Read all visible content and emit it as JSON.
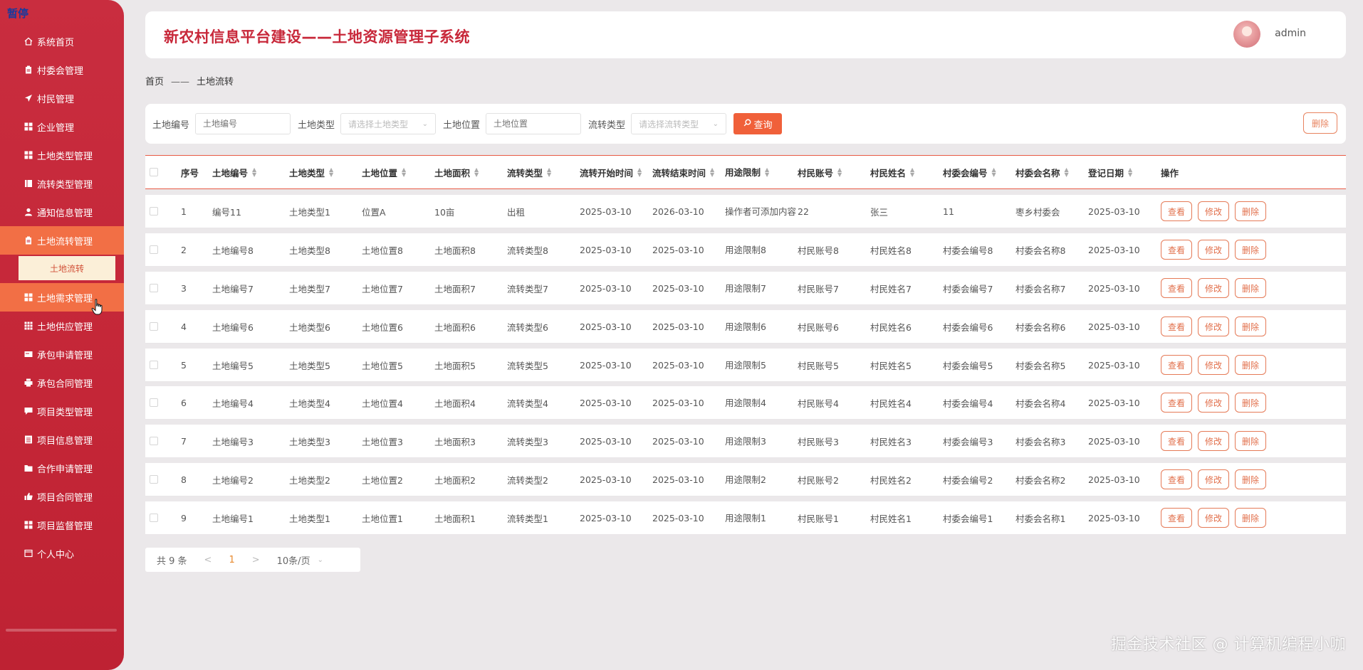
{
  "overlay": {
    "pause_label": "暂停"
  },
  "sidebar": {
    "items": [
      {
        "label": "系统首页",
        "icon": "home-icon"
      },
      {
        "label": "村委会管理",
        "icon": "clipboard-icon"
      },
      {
        "label": "村民管理",
        "icon": "send-icon"
      },
      {
        "label": "企业管理",
        "icon": "grid-icon"
      },
      {
        "label": "土地类型管理",
        "icon": "grid-icon"
      },
      {
        "label": "流转类型管理",
        "icon": "book-icon"
      },
      {
        "label": "通知信息管理",
        "icon": "user-icon"
      },
      {
        "label": "土地流转管理",
        "icon": "clipboard-icon",
        "active": true
      },
      {
        "label": "土地需求管理",
        "icon": "grid-icon",
        "hovered": true
      },
      {
        "label": "土地供应管理",
        "icon": "table-icon"
      },
      {
        "label": "承包申请管理",
        "icon": "card-icon"
      },
      {
        "label": "承包合同管理",
        "icon": "print-icon"
      },
      {
        "label": "项目类型管理",
        "icon": "chat-icon"
      },
      {
        "label": "项目信息管理",
        "icon": "list-icon"
      },
      {
        "label": "合作申请管理",
        "icon": "folder-icon"
      },
      {
        "label": "项目合同管理",
        "icon": "like-icon"
      },
      {
        "label": "项目监督管理",
        "icon": "grid-icon"
      },
      {
        "label": "个人中心",
        "icon": "window-icon"
      }
    ],
    "submenu": {
      "label": "土地流转"
    }
  },
  "header": {
    "title": "新农村信息平台建设——土地资源管理子系统",
    "username": "admin"
  },
  "breadcrumb": {
    "home": "首页",
    "separator": "——",
    "current": "土地流转"
  },
  "search": {
    "fields": [
      {
        "label": "土地编号",
        "placeholder": "土地编号",
        "type": "input"
      },
      {
        "label": "土地类型",
        "placeholder": "请选择土地类型",
        "type": "select"
      },
      {
        "label": "土地位置",
        "placeholder": "土地位置",
        "type": "input"
      },
      {
        "label": "流转类型",
        "placeholder": "请选择流转类型",
        "type": "select"
      }
    ],
    "search_button": "查询",
    "delete_button": "删除"
  },
  "table": {
    "columns": [
      "序号",
      "土地编号",
      "土地类型",
      "土地位置",
      "土地面积",
      "流转类型",
      "流转开始时间",
      "流转结束时间",
      "用途限制",
      "村民账号",
      "村民姓名",
      "村委会编号",
      "村委会名称",
      "登记日期",
      "操作"
    ],
    "actions": {
      "view": "查看",
      "edit": "修改",
      "delete": "删除"
    },
    "rows": [
      [
        "1",
        "编号11",
        "土地类型1",
        "位置A",
        "10亩",
        "出租",
        "2025-03-10",
        "2026-03-10",
        "操作者可添加内容",
        "22",
        "张三",
        "11",
        "枣乡村委会",
        "2025-03-10"
      ],
      [
        "2",
        "土地编号8",
        "土地类型8",
        "土地位置8",
        "土地面积8",
        "流转类型8",
        "2025-03-10",
        "2025-03-10",
        "用途限制8",
        "村民账号8",
        "村民姓名8",
        "村委会编号8",
        "村委会名称8",
        "2025-03-10"
      ],
      [
        "3",
        "土地编号7",
        "土地类型7",
        "土地位置7",
        "土地面积7",
        "流转类型7",
        "2025-03-10",
        "2025-03-10",
        "用途限制7",
        "村民账号7",
        "村民姓名7",
        "村委会编号7",
        "村委会名称7",
        "2025-03-10"
      ],
      [
        "4",
        "土地编号6",
        "土地类型6",
        "土地位置6",
        "土地面积6",
        "流转类型6",
        "2025-03-10",
        "2025-03-10",
        "用途限制6",
        "村民账号6",
        "村民姓名6",
        "村委会编号6",
        "村委会名称6",
        "2025-03-10"
      ],
      [
        "5",
        "土地编号5",
        "土地类型5",
        "土地位置5",
        "土地面积5",
        "流转类型5",
        "2025-03-10",
        "2025-03-10",
        "用途限制5",
        "村民账号5",
        "村民姓名5",
        "村委会编号5",
        "村委会名称5",
        "2025-03-10"
      ],
      [
        "6",
        "土地编号4",
        "土地类型4",
        "土地位置4",
        "土地面积4",
        "流转类型4",
        "2025-03-10",
        "2025-03-10",
        "用途限制4",
        "村民账号4",
        "村民姓名4",
        "村委会编号4",
        "村委会名称4",
        "2025-03-10"
      ],
      [
        "7",
        "土地编号3",
        "土地类型3",
        "土地位置3",
        "土地面积3",
        "流转类型3",
        "2025-03-10",
        "2025-03-10",
        "用途限制3",
        "村民账号3",
        "村民姓名3",
        "村委会编号3",
        "村委会名称3",
        "2025-03-10"
      ],
      [
        "8",
        "土地编号2",
        "土地类型2",
        "土地位置2",
        "土地面积2",
        "流转类型2",
        "2025-03-10",
        "2025-03-10",
        "用途限制2",
        "村民账号2",
        "村民姓名2",
        "村委会编号2",
        "村委会名称2",
        "2025-03-10"
      ],
      [
        "9",
        "土地编号1",
        "土地类型1",
        "土地位置1",
        "土地面积1",
        "流转类型1",
        "2025-03-10",
        "2025-03-10",
        "用途限制1",
        "村民账号1",
        "村民姓名1",
        "村委会编号1",
        "村委会名称1",
        "2025-03-10"
      ]
    ]
  },
  "pagination": {
    "total": "共 9 条",
    "prev": "<",
    "current": "1",
    "next": ">",
    "page_size": "10条/页"
  },
  "watermark": "掘金技术社区 @ 计算机编程小咖",
  "colors": {
    "sidebar": "#c42637",
    "accent": "#f0603a",
    "title": "#c8283a"
  }
}
